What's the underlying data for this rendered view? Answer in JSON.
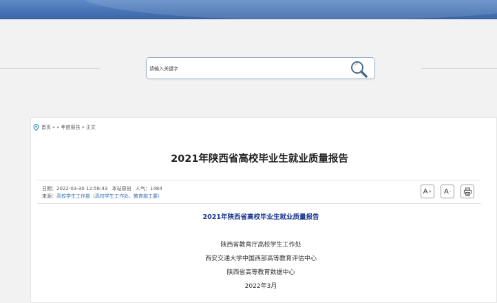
{
  "search": {
    "placeholder": "请输入关键字"
  },
  "breadcrumb": {
    "home": "首页",
    "sep1": "»",
    "sep2": "»",
    "category": "年度报告",
    "sep3": "»",
    "current": "正文"
  },
  "article": {
    "title": "2021年陕西省高校毕业生就业质量报告",
    "meta": {
      "date_label": "日期：",
      "date_value": "2022-03-30 12:56:43",
      "original": "本站原创",
      "views_label": "人气：",
      "views_value": "1484",
      "source_label": "来源：",
      "source_value": "高校学生工作部（高校学生工作处、教育部工委）"
    },
    "tools": {
      "font_increase": "A",
      "font_increase_sup": "+",
      "font_decrease": "A",
      "font_decrease_sup": "-"
    },
    "body": {
      "heading": "2021年陕西省高校毕业生就业质量报告",
      "lines": [
        "陕西省教育厅高校学生工作处",
        "西安交通大学中国西部高等教育评估中心",
        "陕西省高等教育数据中心",
        "2022年3月"
      ]
    }
  },
  "colors": {
    "banner": "#4673b4",
    "heading_blue": "#1f3a93",
    "link": "#3a6fb0",
    "pin": "#2e86c9"
  }
}
